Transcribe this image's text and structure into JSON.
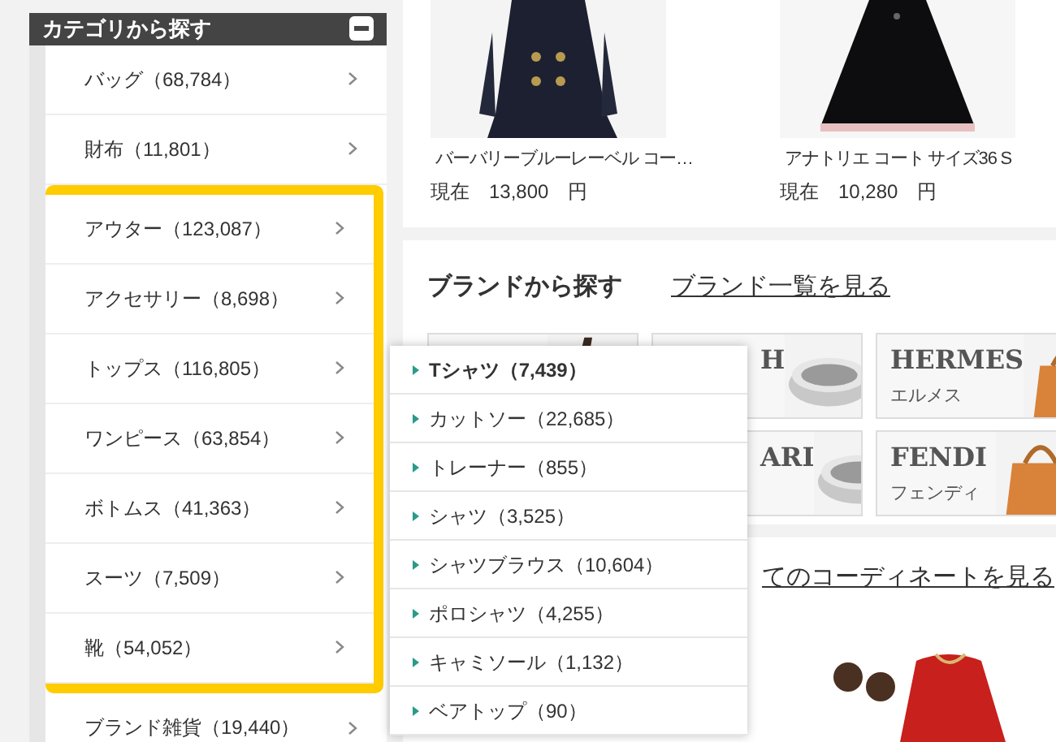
{
  "sidebar": {
    "title": "カテゴリから探す",
    "sections": [
      {
        "highlighted": false,
        "items": [
          {
            "label": "バッグ（68,784）"
          },
          {
            "label": "財布（11,801）"
          }
        ]
      },
      {
        "highlighted": true,
        "items": [
          {
            "label": "アウター（123,087）"
          },
          {
            "label": "アクセサリー（8,698）"
          },
          {
            "label": "トップス（116,805）"
          },
          {
            "label": "ワンピース（63,854）"
          },
          {
            "label": "ボトムス（41,363）"
          },
          {
            "label": "スーツ（7,509）"
          },
          {
            "label": "靴（54,052）"
          }
        ]
      },
      {
        "highlighted": false,
        "items": [
          {
            "label": "ブランド雑貨（19,440）"
          }
        ]
      }
    ]
  },
  "products": [
    {
      "name": "バーバリーブルーレーベル コー…",
      "price_label": "現在",
      "price": "13,800",
      "currency": "円"
    },
    {
      "name": "アナトリエ コート サイズ36 S",
      "price_label": "現在",
      "price": "10,280",
      "currency": "円"
    }
  ],
  "brands": {
    "title": "ブランドから探す",
    "link": "ブランド一覧を見る",
    "tile_rows": [
      [
        {
          "kind": "picture"
        },
        {
          "kind": "brand",
          "name": "H"
        },
        {
          "kind": "brand",
          "name": "HERMES",
          "kana": "エルメス"
        }
      ],
      [
        {
          "kind": "brand",
          "name": "ARI"
        },
        {
          "kind": "brand",
          "name": "FENDI",
          "kana": "フェンディ"
        }
      ]
    ]
  },
  "coordinate": {
    "link": "てのコーディネートを見る"
  },
  "submenu": {
    "items": [
      {
        "label": "Tシャツ（7,439）",
        "selected": true
      },
      {
        "label": "カットソー（22,685）",
        "selected": false
      },
      {
        "label": "トレーナー（855）",
        "selected": false
      },
      {
        "label": "シャツ（3,525）",
        "selected": false
      },
      {
        "label": "シャツブラウス（10,604）",
        "selected": false
      },
      {
        "label": "ポロシャツ（4,255）",
        "selected": false
      },
      {
        "label": "キャミソール（1,132）",
        "selected": false
      },
      {
        "label": "ベアトップ（90）",
        "selected": false
      }
    ]
  }
}
